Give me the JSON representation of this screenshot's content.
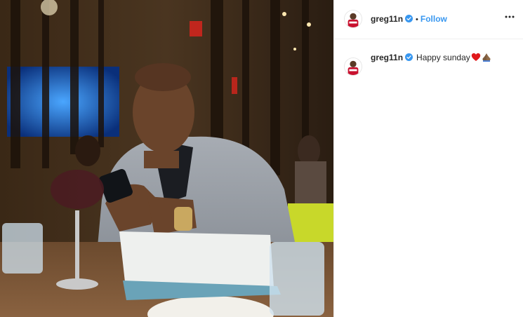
{
  "post": {
    "photo_alt": "Man in grey blazer looking at phone in restaurant",
    "header": {
      "username": "greg11n",
      "separator": "•",
      "follow_label": "Follow",
      "more_icon": "more-options-icon"
    },
    "caption": {
      "username": "greg11n",
      "text": "Happy sunday",
      "emojis": [
        "red-heart-emoji",
        "folded-hands-emoji"
      ]
    }
  },
  "colors": {
    "follow_blue": "#3897f0",
    "verified_blue": "#3897f0",
    "text": "#262626",
    "divider": "#efefef"
  }
}
